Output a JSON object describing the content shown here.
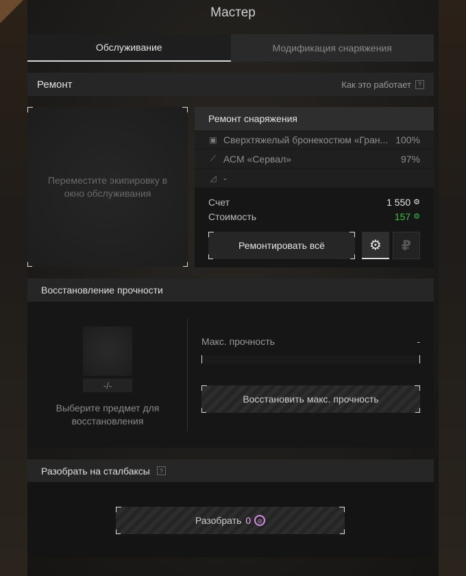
{
  "window": {
    "title": "Мастер"
  },
  "tabs": [
    {
      "label": "Обслуживание",
      "active": true
    },
    {
      "label": "Модификация снаряжения",
      "active": false
    }
  ],
  "repair": {
    "header": "Ремонт",
    "how_it_works": "Как это работает",
    "help_glyph": "?",
    "dropzone_text": "Переместите экипировку в окно обслуживания",
    "panel_title": "Ремонт снаряжения",
    "items": [
      {
        "icon": "armor-icon",
        "name": "Сверхтяжелый бронекостюм «Гран...",
        "percent": "100%"
      },
      {
        "icon": "rifle-icon",
        "name": "АСМ «Сервал»",
        "percent": "97%"
      },
      {
        "icon": "knife-icon",
        "name": "-",
        "percent": ""
      }
    ],
    "account_label": "Счет",
    "account_value": "1 550",
    "cost_label": "Стоимость",
    "cost_value": "157",
    "repair_all_label": "Ремонтировать всё",
    "currency_gear_glyph": "⚙",
    "currency_rub_glyph": "₽"
  },
  "restore": {
    "header": "Восстановление прочности",
    "slot_count": "-/-",
    "hint": "Выберите предмет для восстановления",
    "max_durability_label": "Макс. прочность",
    "max_durability_value": "-",
    "durability_fraction": 0,
    "button_label": "Восстановить макс. прочность"
  },
  "disassemble": {
    "header": "Разобрать на сталбаксы",
    "help_glyph": "?",
    "button_label": "Разобрать",
    "count": "0"
  },
  "colors": {
    "accent_green": "#3fbf4c",
    "stalbucks_purple": "#d88fe6"
  }
}
